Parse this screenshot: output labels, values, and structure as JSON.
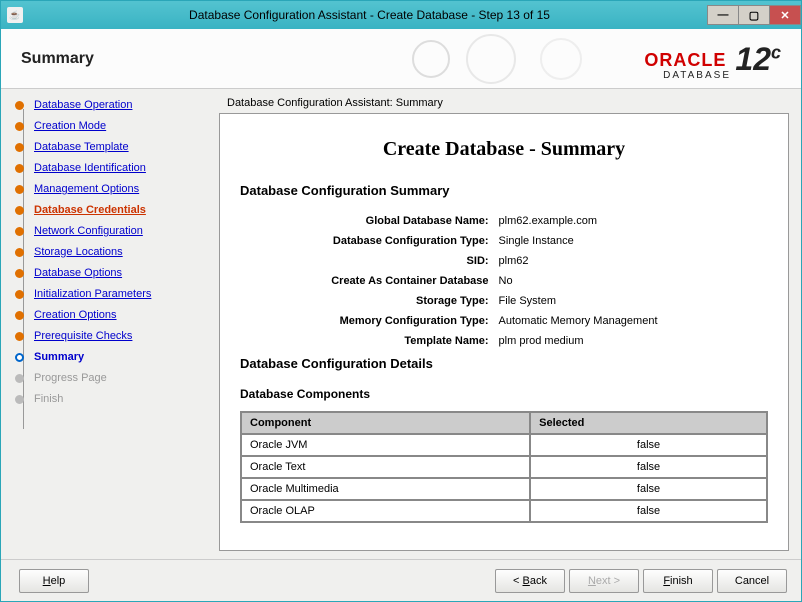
{
  "titlebar": {
    "title": "Database Configuration Assistant - Create Database - Step 13 of 15"
  },
  "header": {
    "title": "Summary",
    "logo_brand": "ORACLE",
    "logo_sub": "DATABASE",
    "logo_version": "12",
    "logo_version_suffix": "c"
  },
  "sidebar": {
    "steps": [
      {
        "label": "Database Operation",
        "state": "done"
      },
      {
        "label": "Creation Mode",
        "state": "done"
      },
      {
        "label": "Database Template",
        "state": "done"
      },
      {
        "label": "Database Identification",
        "state": "done"
      },
      {
        "label": "Management Options",
        "state": "done"
      },
      {
        "label": "Database Credentials",
        "state": "warn"
      },
      {
        "label": "Network Configuration",
        "state": "done"
      },
      {
        "label": "Storage Locations",
        "state": "done"
      },
      {
        "label": "Database Options",
        "state": "done"
      },
      {
        "label": "Initialization Parameters",
        "state": "done"
      },
      {
        "label": "Creation Options",
        "state": "done"
      },
      {
        "label": "Prerequisite Checks",
        "state": "done"
      },
      {
        "label": "Summary",
        "state": "current"
      },
      {
        "label": "Progress Page",
        "state": "disabled"
      },
      {
        "label": "Finish",
        "state": "disabled"
      }
    ]
  },
  "main": {
    "breadcrumb": "Database Configuration Assistant: Summary",
    "heading": "Create Database - Summary",
    "config_summary_title": "Database Configuration Summary",
    "config_details_title": "Database Configuration Details",
    "components_title": "Database Components",
    "summary_rows": [
      {
        "label": "Global Database Name:",
        "value": "plm62.example.com"
      },
      {
        "label": "Database Configuration Type:",
        "value": "Single Instance"
      },
      {
        "label": "SID:",
        "value": "plm62"
      },
      {
        "label": "Create As Container Database",
        "value": "No"
      },
      {
        "label": "Storage Type:",
        "value": "File System"
      },
      {
        "label": "Memory Configuration Type:",
        "value": "Automatic Memory Management"
      },
      {
        "label": "Template Name:",
        "value": "plm prod medium"
      }
    ],
    "components_columns": {
      "c1": "Component",
      "c2": "Selected"
    },
    "components": [
      {
        "name": "Oracle JVM",
        "selected": "false"
      },
      {
        "name": "Oracle Text",
        "selected": "false"
      },
      {
        "name": "Oracle Multimedia",
        "selected": "false"
      },
      {
        "name": "Oracle OLAP",
        "selected": "false"
      }
    ]
  },
  "footer": {
    "help": "Help",
    "back": "< Back",
    "next": "Next >",
    "finish": "Finish",
    "cancel": "Cancel"
  }
}
